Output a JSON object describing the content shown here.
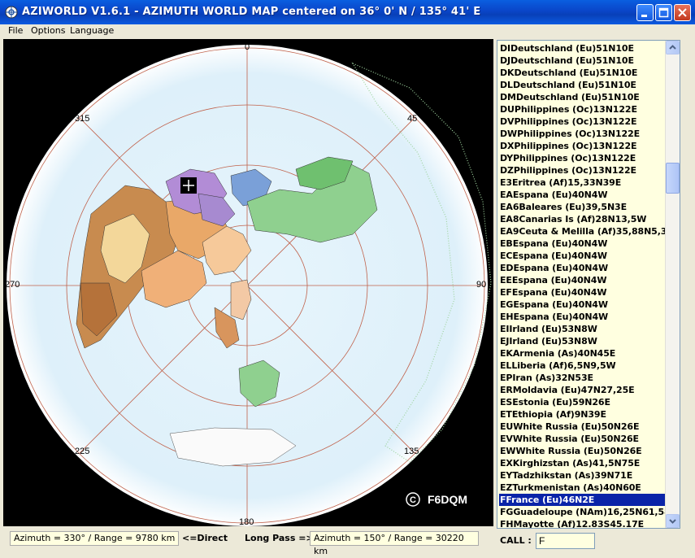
{
  "window": {
    "title": "AZIWORLD V1.6.1 - AZIMUTH WORLD MAP centered on 36° 0' N / 135° 41' E"
  },
  "menu": [
    "File",
    "Options",
    "Language"
  ],
  "map": {
    "degree_labels": [
      "0",
      "45",
      "90",
      "135",
      "180",
      "225",
      "270",
      "315"
    ],
    "copyright_symbol": "C",
    "author": "F6DQM"
  },
  "prefix_list": [
    "DIDeutschland (Eu)51N10E",
    "DJDeutschland (Eu)51N10E",
    "DKDeutschland (Eu)51N10E",
    "DLDeutschland (Eu)51N10E",
    "DMDeutschland (Eu)51N10E",
    "DUPhilippines (Oc)13N122E",
    "DVPhilippines (Oc)13N122E",
    "DWPhilippines (Oc)13N122E",
    "DXPhilippines (Oc)13N122E",
    "DYPhilippines (Oc)13N122E",
    "DZPhilippines (Oc)13N122E",
    "E3Eritrea (Af)15,33N39E",
    "EAEspana (Eu)40N4W",
    "EA6Baleares (Eu)39,5N3E",
    "EA8Canarias Is (Af)28N13,5W",
    "EA9Ceuta & Melilla (Af)35,88N5,32W",
    "EBEspana (Eu)40N4W",
    "ECEspana (Eu)40N4W",
    "EDEspana (Eu)40N4W",
    "EEEspana (Eu)40N4W",
    "EFEspana (Eu)40N4W",
    "EGEspana (Eu)40N4W",
    "EHEspana (Eu)40N4W",
    "EIIrland (Eu)53N8W",
    "EJIrland (Eu)53N8W",
    "EKArmenia (As)40N45E",
    "ELLiberia (Af)6,5N9,5W",
    "EPIran (As)32N53E",
    "ERMoldavia (Eu)47N27,25E",
    "ESEstonia (Eu)59N26E",
    "ETEthiopia (Af)9N39E",
    "EUWhite Russia (Eu)50N26E",
    "EVWhite Russia (Eu)50N26E",
    "EWWhite Russia (Eu)50N26E",
    "EXKirghizstan (As)41,5N75E",
    "EYTadzhikstan (As)39N71E",
    "EZTurkmenistan (As)40N60E",
    "FFrance (Eu)46N2E",
    "FGGuadeloupe (NAm)16,25N61,58W",
    "FHMayotte (Af)12.83S45.17E"
  ],
  "selected_prefix": "FFrance (Eu)46N2E",
  "status": {
    "direct_value": "Azimuth = 330° / Range = 9780 km",
    "direct_label": "<=Direct",
    "long_pass_label": "Long Pass =>",
    "long_pass_value": "Azimuth = 150° / Range = 30220 km",
    "call_label": "CALL :",
    "call_value": "F"
  },
  "colors": {
    "title_bar": "#0a45c8",
    "ocean": "#e6f4fb",
    "grid": "#c0614a",
    "selection": "#0a24a8",
    "list_bg": "#ffffe0"
  }
}
